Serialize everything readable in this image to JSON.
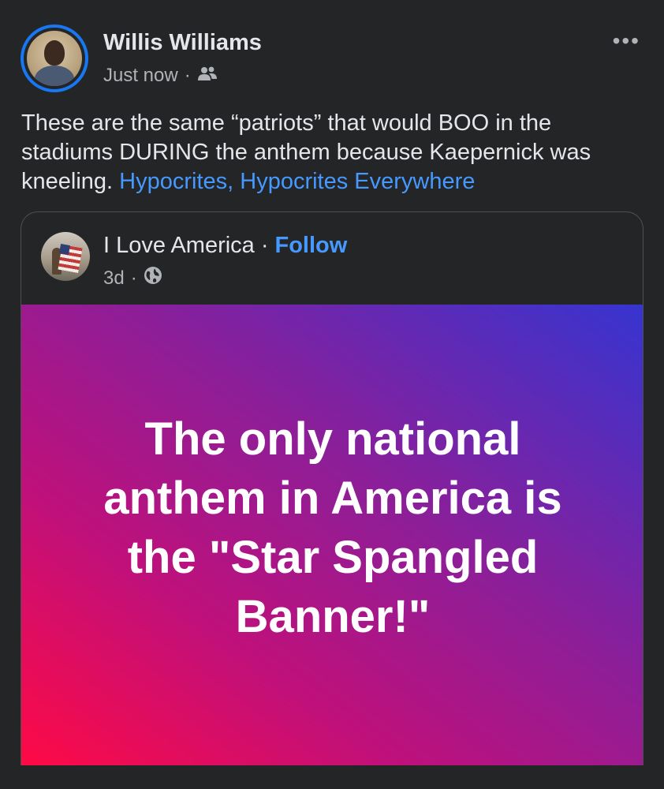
{
  "post": {
    "author": "Willis Williams",
    "time": "Just now",
    "separator": "·",
    "audience_icon": "friends-icon",
    "more_label": "•••",
    "text": "These are the same “patriots” that would BOO in the stadiums DURING the anthem because Kaepernick was kneeling. ",
    "link_text": "Hypocrites, Hypocrites Everywhere"
  },
  "shared": {
    "page_name": "I Love America",
    "separator": "·",
    "follow_label": "Follow",
    "time": "3d",
    "meta_separator": "·",
    "audience_icon": "globe-icon",
    "banner_text": "The only national anthem in America is the \"Star Spangled Banner!\""
  },
  "colors": {
    "background": "#242526",
    "accent": "#1877f2",
    "link": "#4599ff",
    "gradient_start": "#ff0a45",
    "gradient_end": "#3634d0"
  }
}
